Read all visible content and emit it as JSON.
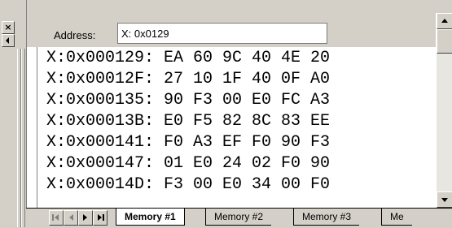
{
  "address": {
    "label": "Address:",
    "value": "X: 0x0129"
  },
  "memory_rows": [
    "X:0x000129: EA 60 9C 40 4E 20",
    "X:0x00012F: 27 10 1F 40 0F A0",
    "X:0x000135: 90 F3 00 E0 FC A3",
    "X:0x00013B: E0 F5 82 8C 83 EE",
    "X:0x000141: F0 A3 EF F0 90 F3",
    "X:0x000147: 01 E0 24 02 F0 90",
    "X:0x00014D: F3 00 E0 34 00 F0"
  ],
  "tabs": [
    {
      "label": "Memory #1",
      "active": true
    },
    {
      "label": "Memory #2",
      "active": false
    },
    {
      "label": "Memory #3",
      "active": false
    },
    {
      "label": "Me",
      "active": false
    }
  ],
  "icons": {
    "close": "close-icon",
    "collapse": "collapse-left-icon"
  }
}
